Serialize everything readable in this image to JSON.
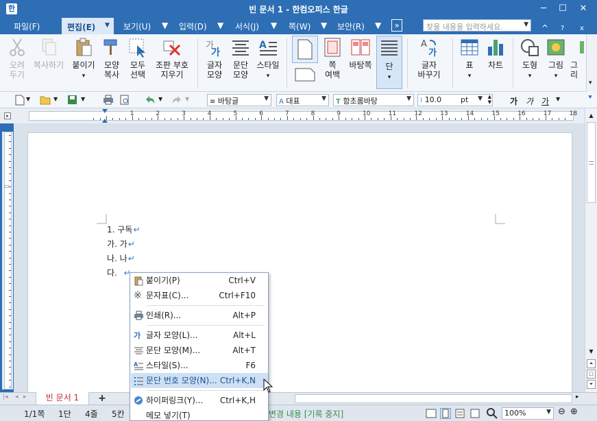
{
  "window": {
    "title": "빈 문서 1 - 한컴오피스 한글",
    "app_icon": "hwp-icon",
    "minimize": "minimize-icon",
    "maximize": "maximize-icon",
    "close": "close-icon"
  },
  "menubar": {
    "items": [
      {
        "label": "파일(F)"
      },
      {
        "label": "편집(E)",
        "active": true
      },
      {
        "label": "보기(U)"
      },
      {
        "label": "입력(D)"
      },
      {
        "label": "서식(J)"
      },
      {
        "label": "쪽(W)"
      },
      {
        "label": "보안(R)"
      }
    ],
    "search_placeholder": "찾을 내용을 입력하세요.",
    "more": "»",
    "help": "?",
    "collapse": "^",
    "close": "x"
  },
  "ribbon": {
    "buttons": [
      {
        "label": "오려\n두기",
        "icon": "scissors-icon",
        "disabled": true
      },
      {
        "label": "복사하기",
        "icon": "copy-icon",
        "disabled": true
      },
      {
        "label": "붙이기",
        "icon": "paste-icon"
      },
      {
        "label": "모양\n복사",
        "icon": "format-painter-icon"
      },
      {
        "label": "모두\n선택",
        "icon": "select-all-icon"
      },
      {
        "label": "조판 부호\n지우기",
        "icon": "clear-codes-icon"
      },
      {
        "label": "글자\n모양",
        "icon": "char-shape-icon"
      },
      {
        "label": "문단\n모양",
        "icon": "para-shape-icon"
      },
      {
        "label": "스타일",
        "icon": "style-icon"
      },
      {
        "label": "",
        "icon": "page-icon"
      },
      {
        "label": "쪽\n여백",
        "icon": "page-margin-icon"
      },
      {
        "label": "바탕쪽",
        "icon": "master-page-icon"
      },
      {
        "label": "단",
        "icon": "columns-icon",
        "active": true
      },
      {
        "label": "글자\n바꾸기",
        "icon": "replace-char-icon"
      },
      {
        "label": "표",
        "icon": "table-icon"
      },
      {
        "label": "차트",
        "icon": "chart-icon"
      },
      {
        "label": "도형",
        "icon": "shape-icon"
      },
      {
        "label": "그림",
        "icon": "picture-icon"
      },
      {
        "label": "그리",
        "icon": "drawing-icon"
      }
    ]
  },
  "toolbar": {
    "style": "바탕글",
    "font_lang": "대표",
    "font": "함초롬바탕",
    "size": "10.0",
    "unit": "pt",
    "bold_glyph": "가",
    "italic_glyph": "가",
    "underline_glyph": "가"
  },
  "ruler": {
    "numbers": [
      "1",
      "2",
      "3",
      "4",
      "5",
      "6",
      "7",
      "8",
      "9",
      "10",
      "11",
      "12",
      "13",
      "14",
      "15",
      "16",
      "17",
      "18"
    ]
  },
  "document": {
    "lines": [
      "1. 구독",
      "가. 가",
      "나. 나",
      "다. "
    ],
    "return_mark": "↵"
  },
  "context_menu": {
    "items": [
      {
        "label": "붙이기(P)",
        "shortcut": "Ctrl+V",
        "icon": "paste-icon"
      },
      {
        "label": "문자표(C)...",
        "shortcut": "Ctrl+F10",
        "icon": "symbol-icon"
      },
      {
        "label": "인쇄(R)...",
        "shortcut": "Alt+P",
        "icon": "print-icon"
      },
      {
        "label": "글자 모양(L)...",
        "shortcut": "Alt+L",
        "icon": "char-shape-icon"
      },
      {
        "label": "문단 모양(M)...",
        "shortcut": "Alt+T",
        "icon": "para-shape-icon"
      },
      {
        "label": "스타일(S)...",
        "shortcut": "F6",
        "icon": "style-icon"
      },
      {
        "label": "문단 번호 모양(N)...",
        "shortcut": "Ctrl+K,N",
        "icon": "numbering-icon",
        "highlighted": true
      },
      {
        "label": "하이퍼링크(Y)...",
        "shortcut": "Ctrl+K,H",
        "icon": "hyperlink-icon"
      },
      {
        "label": "메모 넣기(T)",
        "shortcut": "",
        "icon": "memo-icon"
      }
    ]
  },
  "tabs": {
    "doc_tab": "빈 문서 1",
    "add": "+"
  },
  "status": {
    "page": "1/1쪽",
    "column": "1단",
    "line": "4줄",
    "col": "5칸",
    "track": "변경 내용 [기록 중지]",
    "zoom": "100%"
  }
}
